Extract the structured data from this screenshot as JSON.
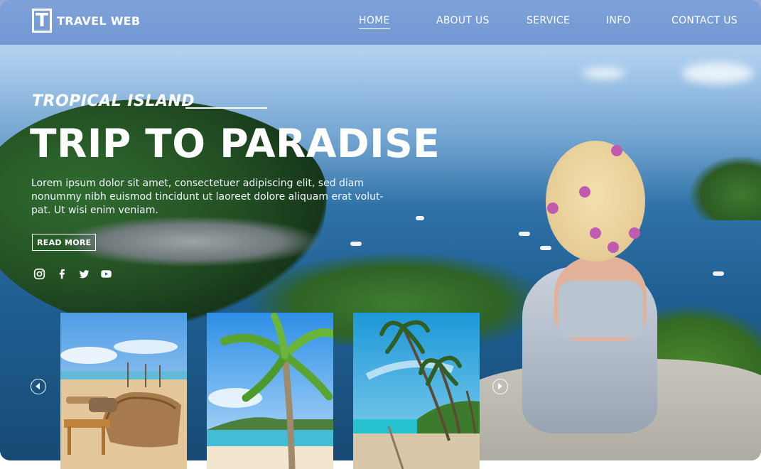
{
  "brand": {
    "logo_letter": "T",
    "name": "TRAVEL WEB"
  },
  "nav": {
    "items": [
      {
        "label": "HOME",
        "active": true
      },
      {
        "label": "ABOUT US",
        "active": false
      },
      {
        "label": "SERVICE",
        "active": false
      },
      {
        "label": "INFO",
        "active": false
      },
      {
        "label": "CONTACT US",
        "active": false
      }
    ]
  },
  "hero": {
    "kicker": "TROPICAL ISLAND",
    "headline": "TRIP TO PARADISE",
    "description": "Lorem ipsum dolor sit amet, consectetuer adipiscing elit, sed diam nonummy nibh euismod tincidunt ut laoreet dolore  aliquam erat volut-pat. Ut wisi enim veniam.",
    "cta_label": "READ MORE"
  },
  "social_icons": [
    "instagram-icon",
    "facebook-icon",
    "twitter-icon",
    "youtube-icon"
  ],
  "carousel": {
    "prev_icon": "chevron-left-icon",
    "next_icon": "chevron-right-icon",
    "cards": [
      "beach-lounge-photo",
      "palm-tree-photo",
      "palm-beach-photo"
    ]
  },
  "colors": {
    "nav_bg": "#3c69be",
    "text": "#ffffff"
  }
}
